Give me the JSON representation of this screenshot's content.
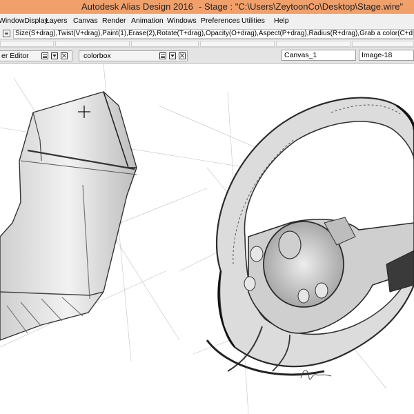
{
  "window": {
    "title": "Autodesk Alias Design 2016",
    "stage": "- Stage : \"C:\\Users\\ZeytoonCo\\Desktop\\Stage.wire\""
  },
  "menu": [
    "WindowDisplay",
    "Layers",
    "Canvas",
    "Render",
    "Animation",
    "Windows",
    "Preferences",
    "Utilities",
    "Help"
  ],
  "hint": "Size(S+drag),Twist(V+drag),Paint(1),Erase(2),Rotate(T+drag),Opacity(O+drag),Aspect(P+drag),Radius(R+drag),Grab a color(C+drag)",
  "panels": {
    "left_tab": "er Editor",
    "colorbox_tab": "colorbox",
    "canvas_field": "Canvas_1",
    "image_field": "Image-18"
  },
  "icons": {
    "hint": "brush-options-icon",
    "panel_menu": "panel-menu-icon",
    "panel_down": "chevron-down-icon",
    "panel_close": "close-icon",
    "cursor": "crosshair-icon"
  },
  "colors": {
    "titlebar": "#f2a06a",
    "menubar": "#f0f0f0",
    "canvas": "#ffffff",
    "sketch": "#3a3a3a"
  }
}
